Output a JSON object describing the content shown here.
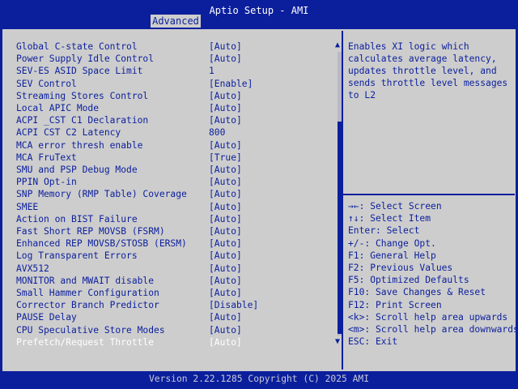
{
  "header": {
    "title": "Aptio Setup - AMI",
    "active_tab": "Advanced"
  },
  "settings": [
    {
      "label": "Global C-state Control",
      "value": "[Auto]"
    },
    {
      "label": "Power Supply Idle Control",
      "value": "[Auto]"
    },
    {
      "label": "SEV-ES ASID Space Limit",
      "value": "1"
    },
    {
      "label": "SEV Control",
      "value": "[Enable]"
    },
    {
      "label": "Streaming Stores Control",
      "value": "[Auto]"
    },
    {
      "label": "Local APIC Mode",
      "value": "[Auto]"
    },
    {
      "label": "ACPI _CST C1 Declaration",
      "value": "[Auto]"
    },
    {
      "label": "ACPI CST C2 Latency",
      "value": "800"
    },
    {
      "label": "MCA error thresh enable",
      "value": "[Auto]"
    },
    {
      "label": "MCA FruText",
      "value": "[True]"
    },
    {
      "label": "SMU and PSP Debug Mode",
      "value": "[Auto]"
    },
    {
      "label": "PPIN Opt-in",
      "value": "[Auto]"
    },
    {
      "label": "SNP Memory (RMP Table) Coverage",
      "value": "[Auto]"
    },
    {
      "label": "SMEE",
      "value": "[Auto]"
    },
    {
      "label": "Action on BIST Failure",
      "value": "[Auto]"
    },
    {
      "label": "Fast Short REP MOVSB (FSRM)",
      "value": "[Auto]"
    },
    {
      "label": "Enhanced REP MOVSB/STOSB (ERSM)",
      "value": "[Auto]"
    },
    {
      "label": "Log Transparent Errors",
      "value": "[Auto]"
    },
    {
      "label": "AVX512",
      "value": "[Auto]"
    },
    {
      "label": "MONITOR and MWAIT disable",
      "value": "[Auto]"
    },
    {
      "label": "Small Hammer Configuration",
      "value": "[Auto]"
    },
    {
      "label": "Corrector Branch Predictor",
      "value": "[Disable]"
    },
    {
      "label": "PAUSE Delay",
      "value": "[Auto]"
    },
    {
      "label": "CPU Speculative Store Modes",
      "value": "[Auto]"
    },
    {
      "label": "Prefetch/Request Throttle",
      "value": "[Auto]"
    }
  ],
  "selected_index": 24,
  "help_text": [
    "Enables XI logic which",
    "calculates average latency,",
    "updates throttle level, and",
    "sends throttle level messages",
    "to L2"
  ],
  "key_help": [
    "→←: Select Screen",
    "↑↓: Select Item",
    "Enter: Select",
    "+/-: Change Opt.",
    "F1: General Help",
    "F2: Previous Values",
    "F5: Optimized Defaults",
    "F10: Save Changes & Reset",
    "F12: Print Screen",
    "<k>: Scroll help area upwards",
    "<m>: Scroll help area downwards",
    "ESC: Exit"
  ],
  "scroll_glyphs": {
    "up": "▲",
    "down": "▼"
  },
  "footer": {
    "text": "Version 2.22.1285 Copyright (C) 2025 AMI"
  },
  "colors": {
    "frame": "#0b1f9c",
    "panel": "#cdcdcd",
    "text": "#0b1f9c",
    "selected_text": "#ffffff"
  }
}
